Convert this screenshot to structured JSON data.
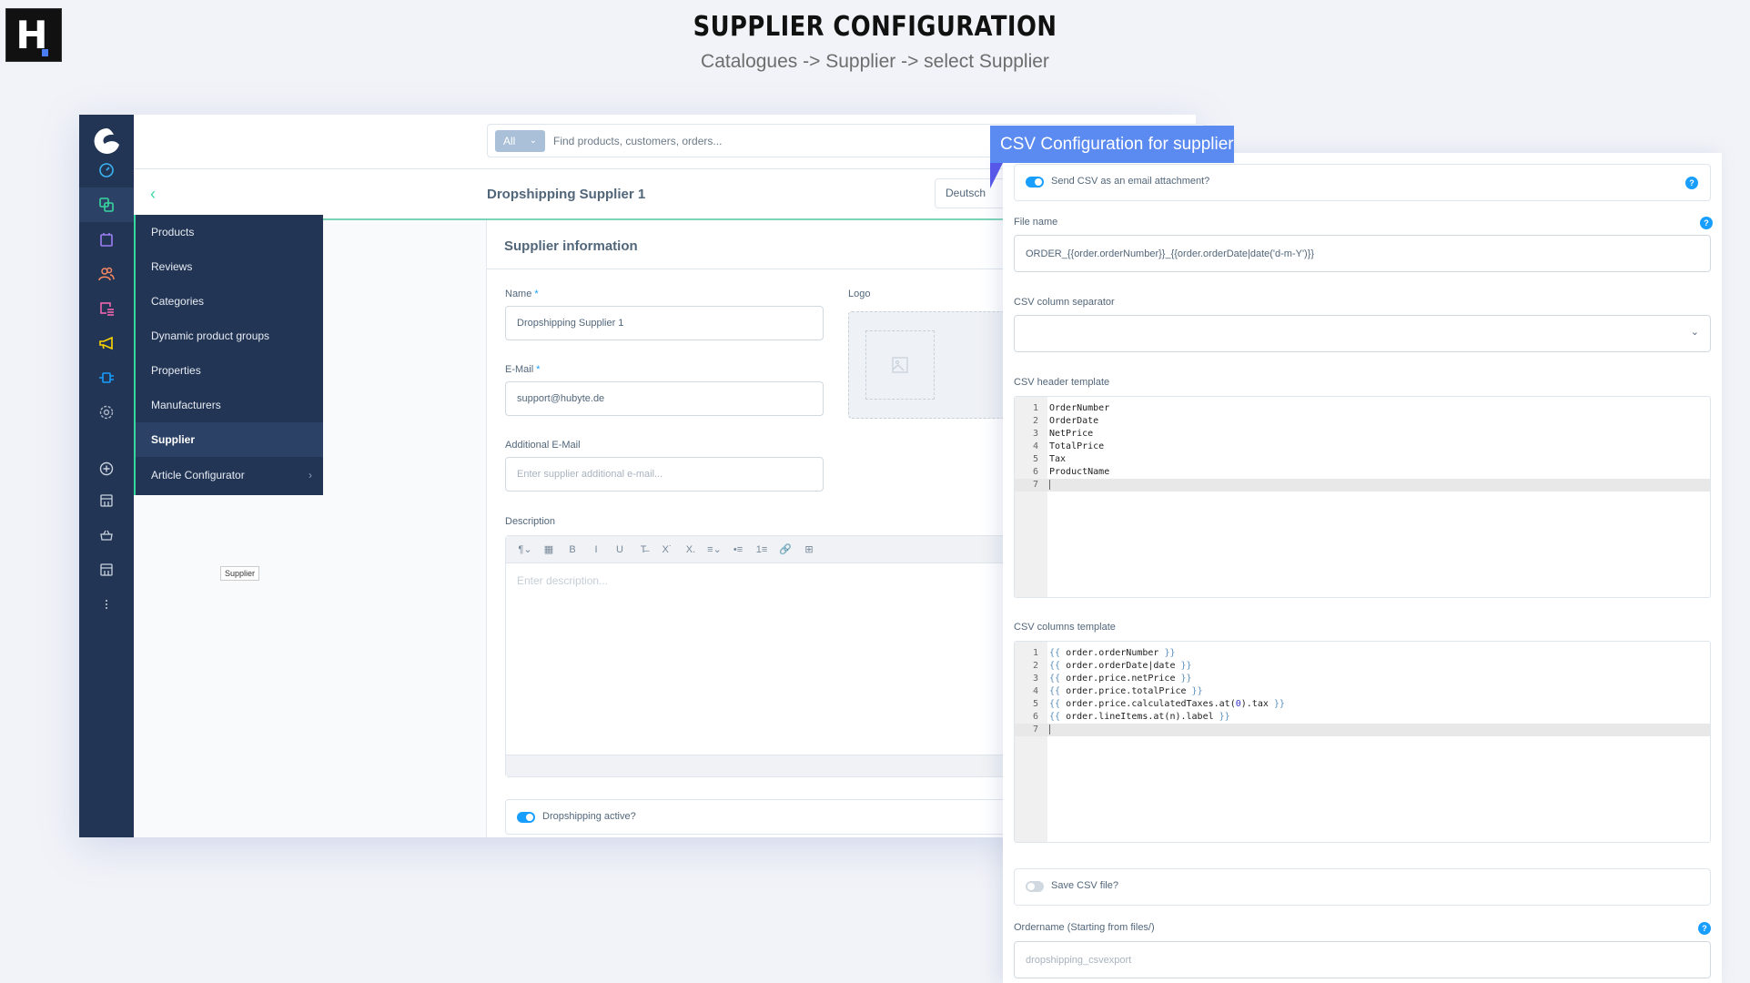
{
  "branding": {
    "logo_letter": "H",
    "title": "SUPPLIER CONFIGURATION",
    "subtitle": "Catalogues -> Supplier -> select Supplier"
  },
  "topbar": {
    "search_scope": "All",
    "search_placeholder": "Find products, customers, orders..."
  },
  "nav_rail": {
    "icons": [
      {
        "name": "dashboard-icon",
        "color": "#3ab3f2"
      },
      {
        "name": "catalogues-icon",
        "color": "#37d7a0",
        "active": true
      },
      {
        "name": "orders-icon",
        "color": "#9d7ff5"
      },
      {
        "name": "customers-icon",
        "color": "#f88962"
      },
      {
        "name": "content-icon",
        "color": "#ff68b4"
      },
      {
        "name": "marketing-icon",
        "color": "#ffd700"
      },
      {
        "name": "extensions-icon",
        "color": "#189eff"
      },
      {
        "name": "settings-icon",
        "color": "#aab5c6"
      },
      {
        "name": "add-sales-channel-icon",
        "color": "#c9d2de"
      },
      {
        "name": "storefront-icon",
        "color": "#c9d2de"
      },
      {
        "name": "headless-icon",
        "color": "#c9d2de"
      },
      {
        "name": "storefront-2-icon",
        "color": "#c9d2de"
      },
      {
        "name": "more-icon",
        "color": "#c9d2de"
      }
    ]
  },
  "flyout": {
    "items": [
      {
        "label": "Products"
      },
      {
        "label": "Reviews"
      },
      {
        "label": "Categories"
      },
      {
        "label": "Dynamic product groups"
      },
      {
        "label": "Properties"
      },
      {
        "label": "Manufacturers"
      },
      {
        "label": "Supplier",
        "active": true
      },
      {
        "label": "Article Configurator",
        "has_children": true
      }
    ],
    "tooltip": "Supplier"
  },
  "smartbar": {
    "title": "Dropshipping Supplier 1",
    "language": "Deutsch"
  },
  "supplier_card": {
    "heading": "Supplier information",
    "name_label": "Name",
    "name_value": "Dropshipping Supplier 1",
    "email_label": "E-Mail",
    "email_value": "support@hubyte.de",
    "additional_email_label": "Additional E-Mail",
    "additional_email_placeholder": "Enter supplier additional e-mail...",
    "logo_label": "Logo",
    "description_label": "Description",
    "description_placeholder": "Enter description...",
    "toolbar": [
      "¶⌄",
      "▦",
      "B",
      "I",
      "U",
      "T̶",
      "X˙",
      "X.",
      "≡⌄",
      "•≡",
      "1≡",
      "🔗",
      "⊞"
    ],
    "dropshipping_active_label": "Dropshipping active?",
    "dropshipping_active": true,
    "required_mark": "*"
  },
  "csv_panel": {
    "banner": "CSV Configuration for supplier",
    "send_attachment_label": "Send CSV as an email attachment?",
    "send_attachment": true,
    "file_name_label": "File name",
    "file_name_value": "ORDER_{{order.orderNumber}}_{{order.orderDate|date('d-m-Y')}}",
    "separator_label": "CSV column separator",
    "separator_value": "",
    "header_template_label": "CSV header template",
    "header_template_lines": [
      "OrderNumber",
      "OrderDate",
      "NetPrice",
      "TotalPrice",
      "Tax",
      "ProductName",
      ""
    ],
    "columns_template_label": "CSV columns template",
    "columns_template_lines": [
      "{{ order.orderNumber }}",
      "{{ order.orderDate|date }}",
      "{{ order.price.netPrice }}",
      "{{ order.price.totalPrice }}",
      "{{ order.price.calculatedTaxes.at(0).tax }}",
      "{{ order.lineItems.at(n).label }}",
      ""
    ],
    "save_csv_label": "Save CSV file?",
    "save_csv": false,
    "ordername_label": "Ordername (Starting from files/)",
    "ordername_placeholder": "dropshipping_csvexport",
    "help_glyph": "?"
  }
}
